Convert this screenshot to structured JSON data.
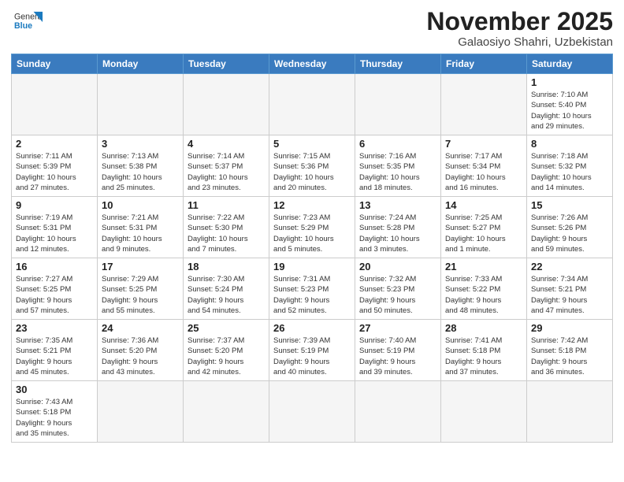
{
  "header": {
    "logo_general": "General",
    "logo_blue": "Blue",
    "month_year": "November 2025",
    "location": "Galaosiyo Shahri, Uzbekistan"
  },
  "days_of_week": [
    "Sunday",
    "Monday",
    "Tuesday",
    "Wednesday",
    "Thursday",
    "Friday",
    "Saturday"
  ],
  "weeks": [
    [
      {
        "day": "",
        "info": ""
      },
      {
        "day": "",
        "info": ""
      },
      {
        "day": "",
        "info": ""
      },
      {
        "day": "",
        "info": ""
      },
      {
        "day": "",
        "info": ""
      },
      {
        "day": "",
        "info": ""
      },
      {
        "day": "1",
        "info": "Sunrise: 7:10 AM\nSunset: 5:40 PM\nDaylight: 10 hours\nand 29 minutes."
      }
    ],
    [
      {
        "day": "2",
        "info": "Sunrise: 7:11 AM\nSunset: 5:39 PM\nDaylight: 10 hours\nand 27 minutes."
      },
      {
        "day": "3",
        "info": "Sunrise: 7:13 AM\nSunset: 5:38 PM\nDaylight: 10 hours\nand 25 minutes."
      },
      {
        "day": "4",
        "info": "Sunrise: 7:14 AM\nSunset: 5:37 PM\nDaylight: 10 hours\nand 23 minutes."
      },
      {
        "day": "5",
        "info": "Sunrise: 7:15 AM\nSunset: 5:36 PM\nDaylight: 10 hours\nand 20 minutes."
      },
      {
        "day": "6",
        "info": "Sunrise: 7:16 AM\nSunset: 5:35 PM\nDaylight: 10 hours\nand 18 minutes."
      },
      {
        "day": "7",
        "info": "Sunrise: 7:17 AM\nSunset: 5:34 PM\nDaylight: 10 hours\nand 16 minutes."
      },
      {
        "day": "8",
        "info": "Sunrise: 7:18 AM\nSunset: 5:32 PM\nDaylight: 10 hours\nand 14 minutes."
      }
    ],
    [
      {
        "day": "9",
        "info": "Sunrise: 7:19 AM\nSunset: 5:31 PM\nDaylight: 10 hours\nand 12 minutes."
      },
      {
        "day": "10",
        "info": "Sunrise: 7:21 AM\nSunset: 5:31 PM\nDaylight: 10 hours\nand 9 minutes."
      },
      {
        "day": "11",
        "info": "Sunrise: 7:22 AM\nSunset: 5:30 PM\nDaylight: 10 hours\nand 7 minutes."
      },
      {
        "day": "12",
        "info": "Sunrise: 7:23 AM\nSunset: 5:29 PM\nDaylight: 10 hours\nand 5 minutes."
      },
      {
        "day": "13",
        "info": "Sunrise: 7:24 AM\nSunset: 5:28 PM\nDaylight: 10 hours\nand 3 minutes."
      },
      {
        "day": "14",
        "info": "Sunrise: 7:25 AM\nSunset: 5:27 PM\nDaylight: 10 hours\nand 1 minute."
      },
      {
        "day": "15",
        "info": "Sunrise: 7:26 AM\nSunset: 5:26 PM\nDaylight: 9 hours\nand 59 minutes."
      }
    ],
    [
      {
        "day": "16",
        "info": "Sunrise: 7:27 AM\nSunset: 5:25 PM\nDaylight: 9 hours\nand 57 minutes."
      },
      {
        "day": "17",
        "info": "Sunrise: 7:29 AM\nSunset: 5:25 PM\nDaylight: 9 hours\nand 55 minutes."
      },
      {
        "day": "18",
        "info": "Sunrise: 7:30 AM\nSunset: 5:24 PM\nDaylight: 9 hours\nand 54 minutes."
      },
      {
        "day": "19",
        "info": "Sunrise: 7:31 AM\nSunset: 5:23 PM\nDaylight: 9 hours\nand 52 minutes."
      },
      {
        "day": "20",
        "info": "Sunrise: 7:32 AM\nSunset: 5:23 PM\nDaylight: 9 hours\nand 50 minutes."
      },
      {
        "day": "21",
        "info": "Sunrise: 7:33 AM\nSunset: 5:22 PM\nDaylight: 9 hours\nand 48 minutes."
      },
      {
        "day": "22",
        "info": "Sunrise: 7:34 AM\nSunset: 5:21 PM\nDaylight: 9 hours\nand 47 minutes."
      }
    ],
    [
      {
        "day": "23",
        "info": "Sunrise: 7:35 AM\nSunset: 5:21 PM\nDaylight: 9 hours\nand 45 minutes."
      },
      {
        "day": "24",
        "info": "Sunrise: 7:36 AM\nSunset: 5:20 PM\nDaylight: 9 hours\nand 43 minutes."
      },
      {
        "day": "25",
        "info": "Sunrise: 7:37 AM\nSunset: 5:20 PM\nDaylight: 9 hours\nand 42 minutes."
      },
      {
        "day": "26",
        "info": "Sunrise: 7:39 AM\nSunset: 5:19 PM\nDaylight: 9 hours\nand 40 minutes."
      },
      {
        "day": "27",
        "info": "Sunrise: 7:40 AM\nSunset: 5:19 PM\nDaylight: 9 hours\nand 39 minutes."
      },
      {
        "day": "28",
        "info": "Sunrise: 7:41 AM\nSunset: 5:18 PM\nDaylight: 9 hours\nand 37 minutes."
      },
      {
        "day": "29",
        "info": "Sunrise: 7:42 AM\nSunset: 5:18 PM\nDaylight: 9 hours\nand 36 minutes."
      }
    ],
    [
      {
        "day": "30",
        "info": "Sunrise: 7:43 AM\nSunset: 5:18 PM\nDaylight: 9 hours\nand 35 minutes."
      },
      {
        "day": "",
        "info": ""
      },
      {
        "day": "",
        "info": ""
      },
      {
        "day": "",
        "info": ""
      },
      {
        "day": "",
        "info": ""
      },
      {
        "day": "",
        "info": ""
      },
      {
        "day": "",
        "info": ""
      }
    ]
  ]
}
